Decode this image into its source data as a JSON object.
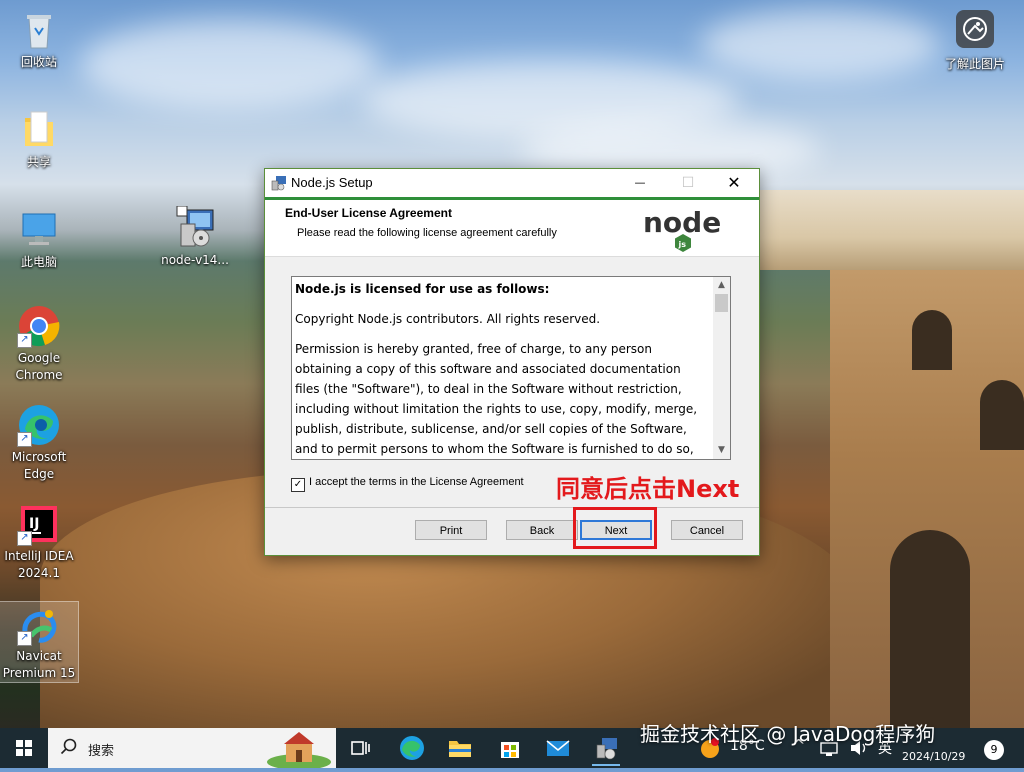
{
  "desktop": {
    "icons": [
      {
        "label": "回收站",
        "icon": "recycle-bin-icon"
      },
      {
        "label": "共享",
        "icon": "folder-icon"
      },
      {
        "label": "此电脑",
        "icon": "computer-icon"
      },
      {
        "label": "node-v14...",
        "icon": "installer-icon"
      },
      {
        "label": "Google\nChrome",
        "icon": "chrome-icon"
      },
      {
        "label": "Microsoft\nEdge",
        "icon": "edge-icon"
      },
      {
        "label": "IntelliJ IDEA\n2024.1",
        "icon": "intellij-icon"
      },
      {
        "label": "Navicat\nPremium 15",
        "icon": "navicat-icon"
      },
      {
        "label": "了解此图片",
        "icon": "camera-icon"
      }
    ]
  },
  "dialog": {
    "title": "Node.js Setup",
    "header_title": "End-User License Agreement",
    "header_subtitle": "Please read the following license agreement carefully",
    "logo_text": "node",
    "logo_sub": "js",
    "license_heading": "Node.js is licensed for use as follows:",
    "license_p1": "Copyright Node.js contributors. All rights reserved.",
    "license_p2": "Permission is hereby granted, free of charge, to any person obtaining a copy of this software and associated documentation files (the \"Software\"), to deal in the Software without restriction, including without limitation the rights to use, copy, modify, merge, publish, distribute, sublicense, and/or sell copies of the Software, and to permit persons to whom the Software is furnished to do so, subject",
    "accept_label": "I accept the terms in the License Agreement",
    "accept_checked": "✓",
    "buttons": {
      "print": "Print",
      "back": "Back",
      "next": "Next",
      "cancel": "Cancel"
    },
    "close_glyph": "✕",
    "minimize_glyph": "—",
    "maximize_glyph": "☐"
  },
  "annotation": {
    "text": "同意后点击Next",
    "color": "#e3191c"
  },
  "taskbar": {
    "search_placeholder": "搜索",
    "weather": "18°C",
    "ime": "英",
    "date": "2024/10/29",
    "notifications": "9"
  },
  "watermark": "掘金技术社区 @ JavaDog程序狗",
  "colors": {
    "node_green": "#3e863d",
    "accent_blue": "#2e78d7"
  }
}
